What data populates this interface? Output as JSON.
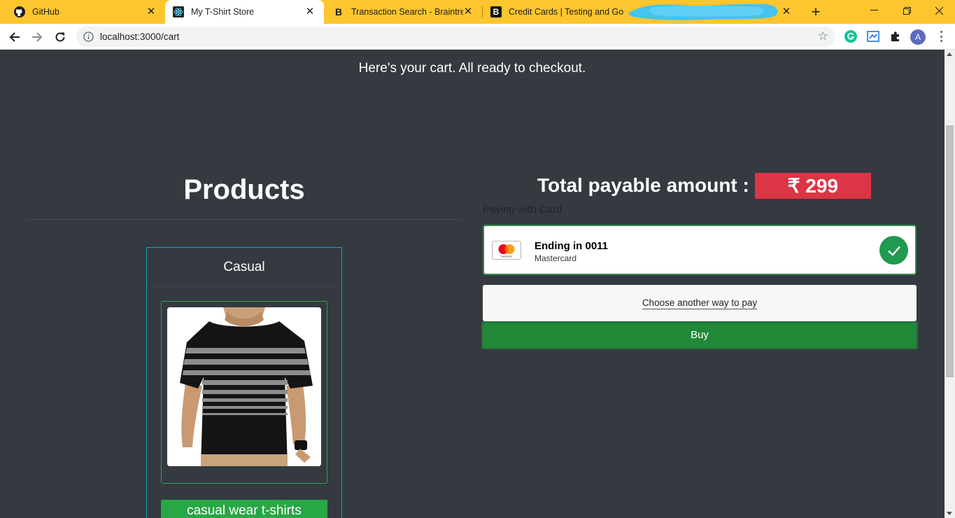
{
  "browser": {
    "tabs": [
      {
        "title": "GitHub",
        "favicon": "github-icon"
      },
      {
        "title": "My T-Shirt Store",
        "favicon": "react-icon"
      },
      {
        "title": "Transaction Search - Braintree",
        "favicon": "braintree-b-icon"
      },
      {
        "title": "Credit Cards | Testing and Go Li",
        "favicon": "braintree-bold-b-icon"
      }
    ],
    "active_tab": 1,
    "address": "localhost:3000/cart"
  },
  "page": {
    "tagline": "Here's your cart. All ready to checkout.",
    "products_title": "Products",
    "product_card": {
      "header": "Casual",
      "name_button": "casual wear t-shirts"
    },
    "total_label": "Total payable amount :",
    "total_amount": "₹ 299",
    "paying_with": "Paying with Card",
    "card": {
      "ending": "Ending in 0011",
      "brand": "Mastercard",
      "logo_text": "mastercard"
    },
    "other_way": "Choose another way to pay",
    "buy": "Buy"
  },
  "colors": {
    "tabbar": "#fdc52e",
    "page_bg": "#343a40",
    "card_border": "#17a2b8",
    "success": "#28a745",
    "danger": "#dc3545"
  }
}
